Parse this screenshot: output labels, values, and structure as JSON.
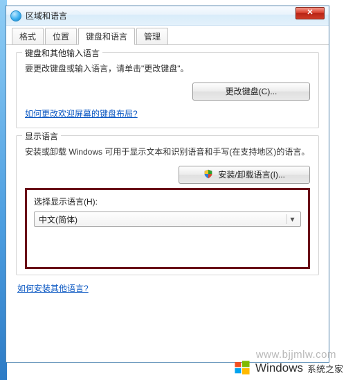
{
  "window": {
    "title": "区域和语言"
  },
  "tabs": {
    "format": "格式",
    "location": "位置",
    "keyboards": "键盘和语言",
    "admin": "管理"
  },
  "group_kb": {
    "title": "键盘和其他输入语言",
    "desc": "要更改键盘或输入语言，请单击\"更改键盘\"。",
    "change_btn": "更改键盘(C)...",
    "link": "如何更改欢迎屏幕的键盘布局?"
  },
  "group_disp": {
    "title": "显示语言",
    "desc": "安装或卸载 Windows 可用于显示文本和识别语音和手写(在支持地区)的语言。",
    "install_btn": "安装/卸载语言(I)...",
    "choose_label": "选择显示语言(H):",
    "selected": "中文(简体)"
  },
  "bottom_link": "如何安装其他语言?",
  "watermark": {
    "url": "www.bjjmlw.com",
    "brand_main": "Windows",
    "brand_sub": "系统之家"
  }
}
